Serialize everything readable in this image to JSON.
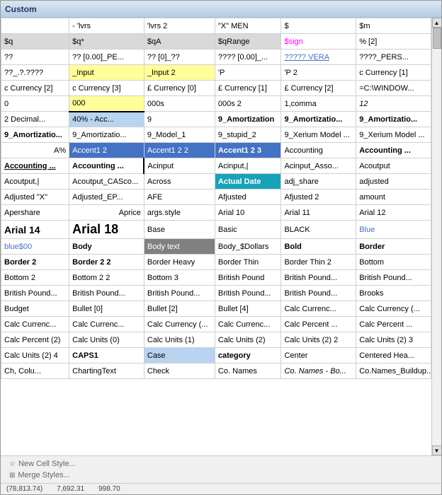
{
  "window": {
    "title": "Custom"
  },
  "footer": {
    "new_style_label": "New Cell Style...",
    "merge_styles_label": "Merge Styles..."
  },
  "status": {
    "val1": "(78,813.74)",
    "val2": "7,692.31",
    "val3": "998.70"
  },
  "rows": [
    [
      {
        "text": "",
        "style": ""
      },
      {
        "text": "- 'lvrs",
        "style": ""
      },
      {
        "text": "'lvrs 2",
        "style": ""
      },
      {
        "text": "\"X\" MEN",
        "style": ""
      },
      {
        "text": "$",
        "style": ""
      },
      {
        "text": "$m",
        "style": ""
      }
    ],
    [
      {
        "text": "$q",
        "style": "highlight-gray"
      },
      {
        "text": "$q*",
        "style": "highlight-gray"
      },
      {
        "text": "$qA",
        "style": "highlight-gray"
      },
      {
        "text": "$qRange",
        "style": "highlight-gray"
      },
      {
        "text": "$sign",
        "style": "pink-text"
      },
      {
        "text": "% [2]",
        "style": ""
      }
    ],
    [
      {
        "text": "??",
        "style": ""
      },
      {
        "text": "?? [0.00]_PE...",
        "style": ""
      },
      {
        "text": "?? [0]_??",
        "style": ""
      },
      {
        "text": "???? [0.00]_...",
        "style": ""
      },
      {
        "text": "????? VERA",
        "style": "blue-text underline-text"
      },
      {
        "text": "????_PERS...",
        "style": ""
      }
    ],
    [
      {
        "text": "??_.?.????",
        "style": ""
      },
      {
        "text": "_Input",
        "style": "highlight-yellow"
      },
      {
        "text": "_Input 2",
        "style": "highlight-yellow"
      },
      {
        "text": "'P",
        "style": ""
      },
      {
        "text": "'P 2",
        "style": ""
      },
      {
        "text": "c Currency [1]",
        "style": ""
      }
    ],
    [
      {
        "text": "c Currency [2]",
        "style": ""
      },
      {
        "text": "c Currency [3]",
        "style": ""
      },
      {
        "text": "£ Currency [0]",
        "style": ""
      },
      {
        "text": "£ Currency [1]",
        "style": ""
      },
      {
        "text": "£ Currency [2]",
        "style": ""
      },
      {
        "text": "=C:\\WINDOW...",
        "style": ""
      }
    ],
    [
      {
        "text": "0",
        "style": ""
      },
      {
        "text": "000",
        "style": "highlight-yellow border-bottom-only"
      },
      {
        "text": "000s",
        "style": ""
      },
      {
        "text": "000s 2",
        "style": ""
      },
      {
        "text": "1,comma",
        "style": ""
      },
      {
        "text": "12",
        "style": "italic-text"
      }
    ],
    [
      {
        "text": "2 Decimal...",
        "style": ""
      },
      {
        "text": "40% - Acc...",
        "style": "highlight-light-blue"
      },
      {
        "text": "9",
        "style": ""
      },
      {
        "text": "9_Amortization",
        "style": "bold-text"
      },
      {
        "text": "9_Amortizatio...",
        "style": "bold-text"
      },
      {
        "text": "9_Amortizatio...",
        "style": "bold-text"
      }
    ],
    [
      {
        "text": "9_Amortizatio...",
        "style": "bold-text"
      },
      {
        "text": "9_Amortizatio...",
        "style": ""
      },
      {
        "text": "9_Model_1",
        "style": ""
      },
      {
        "text": "9_stupid_2",
        "style": ""
      },
      {
        "text": "9_Xerium Model ...",
        "style": ""
      },
      {
        "text": "9_Xerium Model ...",
        "style": ""
      }
    ],
    [
      {
        "text": "A%",
        "style": "right-align"
      },
      {
        "text": "Accent1 2",
        "style": "highlight-blue"
      },
      {
        "text": "Accent1 2 2",
        "style": "highlight-blue"
      },
      {
        "text": "Accent1 2 3",
        "style": "highlight-blue bold-text"
      },
      {
        "text": "Accounting",
        "style": ""
      },
      {
        "text": "Accounting ...",
        "style": "bold-text"
      }
    ],
    [
      {
        "text": "Accounting ...",
        "style": "bold-text underline-text"
      },
      {
        "text": "Accounting ...",
        "style": "bold-text"
      },
      {
        "text": "Acinput",
        "style": "border-left-bold"
      },
      {
        "text": "Acinput,|",
        "style": ""
      },
      {
        "text": "Acinput_Asso...",
        "style": ""
      },
      {
        "text": "Acoutput",
        "style": ""
      }
    ],
    [
      {
        "text": "Acoutput,|",
        "style": ""
      },
      {
        "text": "Acoutput_CASco...",
        "style": ""
      },
      {
        "text": "Across",
        "style": ""
      },
      {
        "text": "Actual Date",
        "style": "highlight-teal bold-text"
      },
      {
        "text": "adj_share",
        "style": ""
      },
      {
        "text": "adjusted",
        "style": ""
      }
    ],
    [
      {
        "text": "Adjusted \"X\"",
        "style": ""
      },
      {
        "text": "Adjusted_EP...",
        "style": ""
      },
      {
        "text": "AFE",
        "style": ""
      },
      {
        "text": "Afjusted",
        "style": ""
      },
      {
        "text": "Afjusted 2",
        "style": ""
      },
      {
        "text": "amount",
        "style": ""
      }
    ],
    [
      {
        "text": "Apershare",
        "style": "border-right-bold"
      },
      {
        "text": "Aprice",
        "style": "right-align"
      },
      {
        "text": "args.style",
        "style": ""
      },
      {
        "text": "Arial 10",
        "style": ""
      },
      {
        "text": "Arial 11",
        "style": ""
      },
      {
        "text": "Arial 12",
        "style": ""
      }
    ],
    [
      {
        "text": "Arial 14",
        "style": "large-font-14"
      },
      {
        "text": "Arial 18",
        "style": "large-font"
      },
      {
        "text": "Base",
        "style": ""
      },
      {
        "text": "Basic",
        "style": ""
      },
      {
        "text": "BLACK",
        "style": ""
      },
      {
        "text": "Blue",
        "style": "blue-text"
      }
    ],
    [
      {
        "text": "blue$00",
        "style": "blue-text"
      },
      {
        "text": "Body",
        "style": "bold-text"
      },
      {
        "text": "Body text",
        "style": "highlight-dark-gray"
      },
      {
        "text": "Body_$Dollars",
        "style": ""
      },
      {
        "text": "Bold",
        "style": "bold-text"
      },
      {
        "text": "Border",
        "style": "bold-text"
      }
    ],
    [
      {
        "text": "Border 2",
        "style": "bold-text"
      },
      {
        "text": "Border 2 2",
        "style": "bold-text"
      },
      {
        "text": "Border Heavy",
        "style": ""
      },
      {
        "text": "Border Thin",
        "style": ""
      },
      {
        "text": "Border Thin 2",
        "style": ""
      },
      {
        "text": "Bottom",
        "style": ""
      }
    ],
    [
      {
        "text": "Bottom 2",
        "style": ""
      },
      {
        "text": "Bottom 2 2",
        "style": ""
      },
      {
        "text": "Bottom 3",
        "style": ""
      },
      {
        "text": "British Pound",
        "style": ""
      },
      {
        "text": "British Pound...",
        "style": ""
      },
      {
        "text": "British Pound...",
        "style": ""
      }
    ],
    [
      {
        "text": "British Pound...",
        "style": ""
      },
      {
        "text": "British Pound...",
        "style": ""
      },
      {
        "text": "British Pound...",
        "style": ""
      },
      {
        "text": "British Pound...",
        "style": ""
      },
      {
        "text": "British Pound...",
        "style": ""
      },
      {
        "text": "Brooks",
        "style": ""
      }
    ],
    [
      {
        "text": "Budget",
        "style": ""
      },
      {
        "text": "Bullet [0]",
        "style": ""
      },
      {
        "text": "Bullet [2]",
        "style": ""
      },
      {
        "text": "Bullet [4]",
        "style": ""
      },
      {
        "text": "Calc Currenc...",
        "style": ""
      },
      {
        "text": "Calc Currency (...",
        "style": ""
      }
    ],
    [
      {
        "text": "Calc Currenc...",
        "style": ""
      },
      {
        "text": "Calc Currenc...",
        "style": ""
      },
      {
        "text": "Calc Currency (...",
        "style": ""
      },
      {
        "text": "Calc Currenc...",
        "style": ""
      },
      {
        "text": "Calc Percent ...",
        "style": ""
      },
      {
        "text": "Calc Percent ...",
        "style": ""
      }
    ],
    [
      {
        "text": "Calc Percent (2)",
        "style": ""
      },
      {
        "text": "Calc Units (0)",
        "style": ""
      },
      {
        "text": "Calc Units (1)",
        "style": ""
      },
      {
        "text": "Calc Units (2)",
        "style": ""
      },
      {
        "text": "Calc Units (2) 2",
        "style": ""
      },
      {
        "text": "Calc Units (2) 3",
        "style": ""
      }
    ],
    [
      {
        "text": "Calc Units (2) 4",
        "style": ""
      },
      {
        "text": "CAPS1",
        "style": "bold-text"
      },
      {
        "text": "Case",
        "style": "highlight-light-blue"
      },
      {
        "text": "category",
        "style": "bold-text"
      },
      {
        "text": "Center",
        "style": ""
      },
      {
        "text": "Centered Hea...",
        "style": ""
      }
    ],
    [
      {
        "text": "Ch, Colu...",
        "style": ""
      },
      {
        "text": "ChartingText",
        "style": ""
      },
      {
        "text": "Check",
        "style": ""
      },
      {
        "text": "Co. Names",
        "style": ""
      },
      {
        "text": "Co. Names - Bo...",
        "style": "italic-text"
      },
      {
        "text": "Co.Names_Buildup...",
        "style": ""
      }
    ]
  ]
}
